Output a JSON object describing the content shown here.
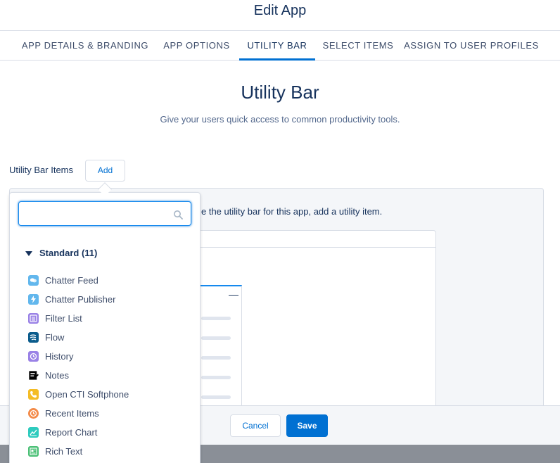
{
  "modal": {
    "title": "Edit App"
  },
  "tabs": [
    {
      "label": "APP DETAILS & BRANDING"
    },
    {
      "label": "APP OPTIONS"
    },
    {
      "label": "UTILITY BAR"
    },
    {
      "label": "SELECT ITEMS"
    },
    {
      "label": "ASSIGN TO USER PROFILES"
    }
  ],
  "section": {
    "title": "Utility Bar",
    "subtitle": "Give your users quick access to common productivity tools."
  },
  "utility": {
    "label": "Utility Bar Items",
    "add_label": "Add",
    "panel_message": "e the utility bar for this app, add a utility item."
  },
  "dropdown": {
    "search_placeholder": "",
    "group_label": "Standard (11)",
    "items": [
      {
        "label": "Chatter Feed",
        "icon": "chatter-feed-icon",
        "color": "#62b7ed"
      },
      {
        "label": "Chatter Publisher",
        "icon": "lightning-icon",
        "color": "#62b7ed"
      },
      {
        "label": "Filter List",
        "icon": "list-icon",
        "color": "#9a82e6"
      },
      {
        "label": "Flow",
        "icon": "flow-icon",
        "color": "#0b5c8c"
      },
      {
        "label": "History",
        "icon": "clock-icon",
        "color": "#9a82e6"
      },
      {
        "label": "Notes",
        "icon": "notes-icon",
        "color": "#000000"
      },
      {
        "label": "Open CTI Softphone",
        "icon": "phone-icon",
        "color": "#f4bc25"
      },
      {
        "label": "Recent Items",
        "icon": "clock-icon",
        "color": "#f38b49"
      },
      {
        "label": "Report Chart",
        "icon": "chart-icon",
        "color": "#2ecbbe"
      },
      {
        "label": "Rich Text",
        "icon": "text-icon",
        "color": "#4bc076"
      }
    ]
  },
  "footer": {
    "cancel_label": "Cancel",
    "save_label": "Save"
  },
  "colors": {
    "brand": "#0070d2",
    "text": "#16325c"
  }
}
